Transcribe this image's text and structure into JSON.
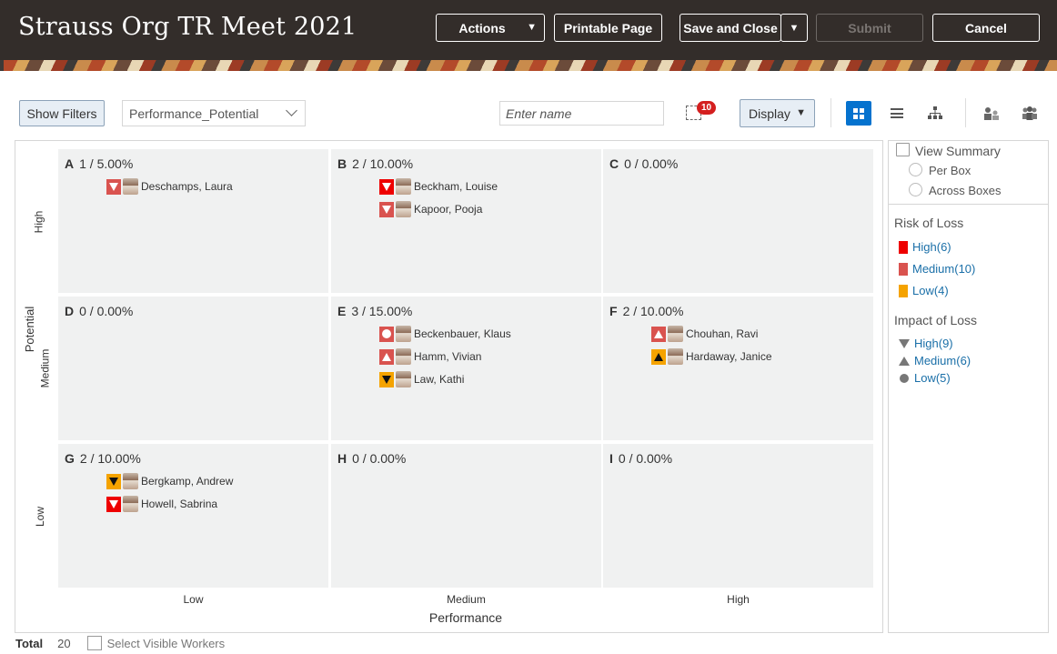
{
  "header": {
    "title": "Strauss Org TR Meet 2021",
    "actions_label": "Actions",
    "printable_label": "Printable Page",
    "save_close_label": "Save and Close",
    "submit_label": "Submit",
    "cancel_label": "Cancel",
    "caret": "▼"
  },
  "toolbar": {
    "show_filters_label": "Show Filters",
    "selected_view": "Performance_Potential",
    "search_placeholder": "Enter name",
    "tray_count": "10",
    "display_label": "Display"
  },
  "grid": {
    "y_axis_title": "Potential",
    "y_levels": [
      "High",
      "Medium",
      "Low"
    ],
    "x_axis_title": "Performance",
    "x_levels": [
      "Low",
      "Medium",
      "High"
    ],
    "cells": [
      {
        "id": "A",
        "summary": "1 / 5.00%",
        "workers": [
          {
            "name": "Deschamps, Laura",
            "risk": "medium",
            "impact": "high"
          }
        ]
      },
      {
        "id": "B",
        "summary": "2 / 10.00%",
        "workers": [
          {
            "name": "Beckham, Louise",
            "risk": "high",
            "impact": "high"
          },
          {
            "name": "Kapoor, Pooja",
            "risk": "medium",
            "impact": "high"
          }
        ]
      },
      {
        "id": "C",
        "summary": "0 / 0.00%",
        "workers": []
      },
      {
        "id": "D",
        "summary": "0 / 0.00%",
        "workers": []
      },
      {
        "id": "E",
        "summary": "3 / 15.00%",
        "workers": [
          {
            "name": "Beckenbauer, Klaus",
            "risk": "medium",
            "impact": "low"
          },
          {
            "name": "Hamm, Vivian",
            "risk": "medium",
            "impact": "medium"
          },
          {
            "name": "Law, Kathi",
            "risk": "low",
            "impact": "high"
          }
        ]
      },
      {
        "id": "F",
        "summary": "2 / 10.00%",
        "workers": [
          {
            "name": "Chouhan, Ravi",
            "risk": "medium",
            "impact": "medium"
          },
          {
            "name": "Hardaway, Janice",
            "risk": "low",
            "impact": "medium"
          }
        ]
      },
      {
        "id": "G",
        "summary": "2 / 10.00%",
        "workers": [
          {
            "name": "Bergkamp, Andrew",
            "risk": "low",
            "impact": "high"
          },
          {
            "name": "Howell, Sabrina",
            "risk": "high",
            "impact": "high"
          }
        ]
      },
      {
        "id": "H",
        "summary": "0 / 0.00%",
        "workers": []
      },
      {
        "id": "I",
        "summary": "0 / 0.00%",
        "workers": []
      }
    ]
  },
  "side": {
    "view_summary_label": "View Summary",
    "per_box_label": "Per Box",
    "across_boxes_label": "Across Boxes",
    "risk_title": "Risk of Loss",
    "risk_items": [
      {
        "label": "High(6)",
        "color": "#ee0000"
      },
      {
        "label": "Medium(10)",
        "color": "#d9534f"
      },
      {
        "label": "Low(4)",
        "color": "#f5a300"
      }
    ],
    "impact_title": "Impact of Loss",
    "impact_items": [
      {
        "label": "High(9)",
        "icon": "triangle-down-icon"
      },
      {
        "label": "Medium(6)",
        "icon": "triangle-up-icon"
      },
      {
        "label": "Low(5)",
        "icon": "circle-icon"
      }
    ]
  },
  "footer": {
    "total_label": "Total",
    "total_value": "20",
    "select_visible_label": "Select Visible Workers"
  },
  "colors": {
    "header_bg": "#332d2a",
    "accent": "#0572ce",
    "risk_high": "#ee0000",
    "risk_medium": "#d9534f",
    "risk_low": "#f5a300"
  }
}
